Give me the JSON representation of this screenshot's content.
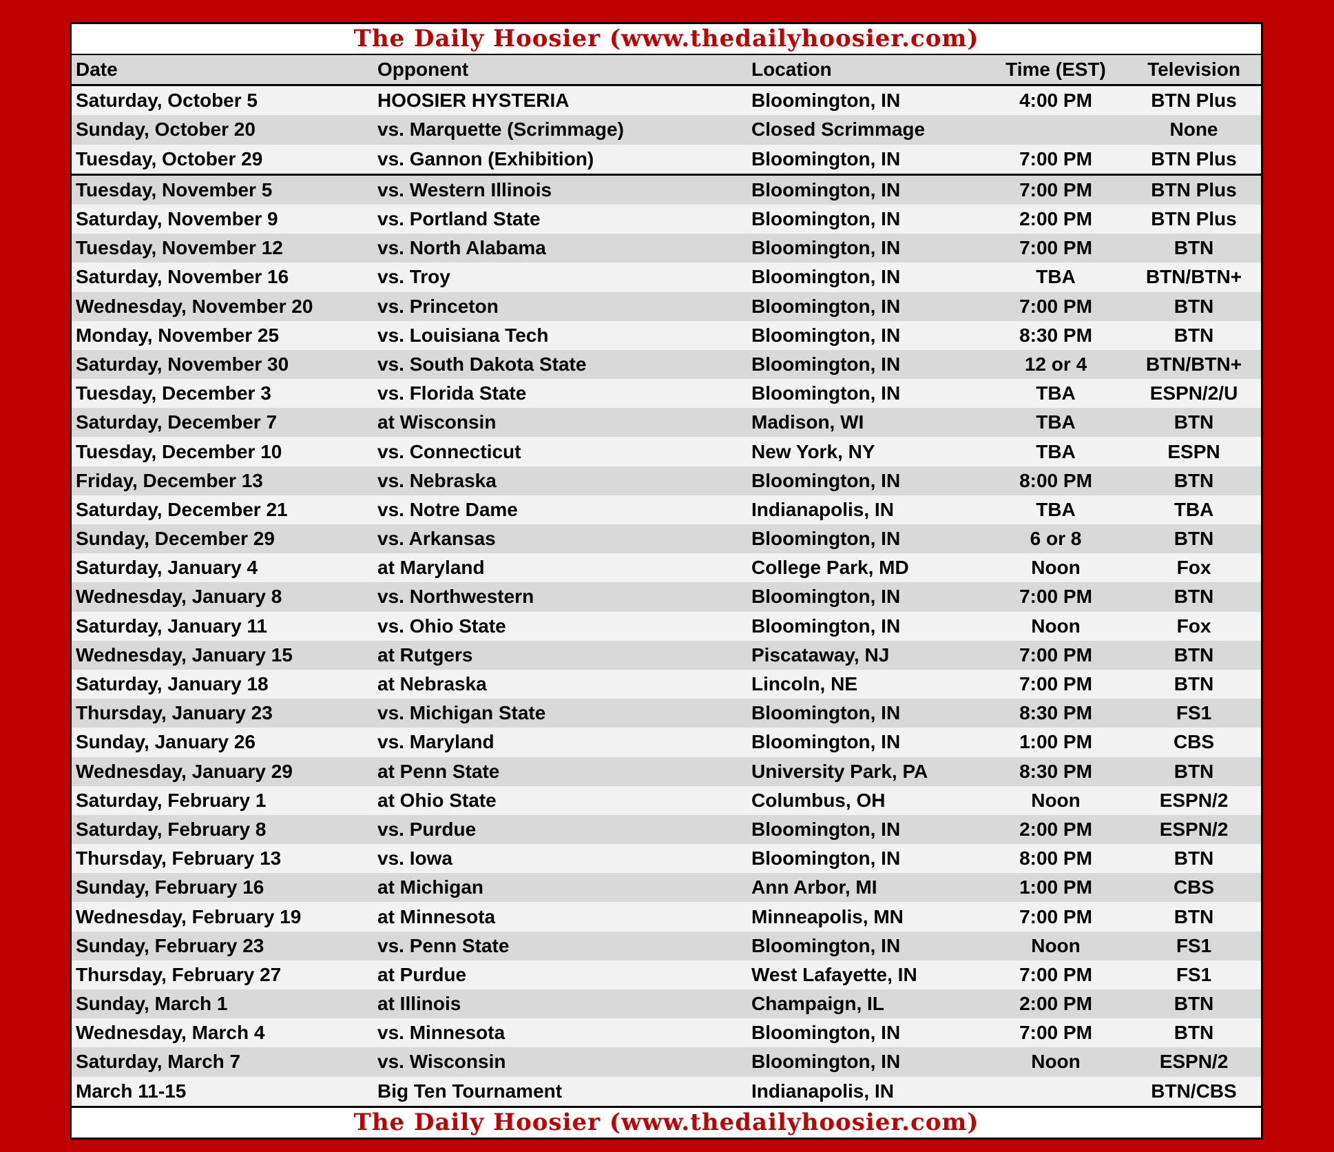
{
  "banner": "The Daily Hoosier (www.thedailyhoosier.com)",
  "columns": [
    "Date",
    "Opponent",
    "Location",
    "Time (EST)",
    "Television"
  ],
  "rows": [
    {
      "date": "Saturday, October 5",
      "opponent": "HOOSIER HYSTERIA",
      "location": "Bloomington, IN",
      "time": "4:00 PM",
      "tv": "BTN Plus"
    },
    {
      "date": "Sunday, October 20",
      "opponent": "vs. Marquette (Scrimmage)",
      "location": "Closed Scrimmage",
      "time": "",
      "tv": "None"
    },
    {
      "date": "Tuesday, October 29",
      "opponent": "vs. Gannon (Exhibition)",
      "location": "Bloomington, IN",
      "time": "7:00 PM",
      "tv": "BTN Plus"
    },
    {
      "date": "Tuesday, November 5",
      "opponent": "vs. Western Illinois",
      "location": "Bloomington, IN",
      "time": "7:00 PM",
      "tv": "BTN Plus"
    },
    {
      "date": "Saturday, November 9",
      "opponent": "vs. Portland State",
      "location": "Bloomington, IN",
      "time": "2:00 PM",
      "tv": "BTN Plus"
    },
    {
      "date": "Tuesday, November 12",
      "opponent": "vs. North Alabama",
      "location": "Bloomington, IN",
      "time": "7:00 PM",
      "tv": "BTN"
    },
    {
      "date": "Saturday, November 16",
      "opponent": "vs. Troy",
      "location": "Bloomington, IN",
      "time": "TBA",
      "tv": "BTN/BTN+"
    },
    {
      "date": "Wednesday, November 20",
      "opponent": "vs. Princeton",
      "location": "Bloomington, IN",
      "time": "7:00 PM",
      "tv": "BTN"
    },
    {
      "date": "Monday, November 25",
      "opponent": "vs. Louisiana Tech",
      "location": "Bloomington, IN",
      "time": "8:30 PM",
      "tv": "BTN"
    },
    {
      "date": "Saturday, November 30",
      "opponent": "vs. South Dakota State",
      "location": "Bloomington, IN",
      "time": "12 or 4",
      "tv": "BTN/BTN+"
    },
    {
      "date": "Tuesday, December 3",
      "opponent": "vs. Florida State",
      "location": "Bloomington, IN",
      "time": "TBA",
      "tv": "ESPN/2/U"
    },
    {
      "date": "Saturday, December 7",
      "opponent": "at Wisconsin",
      "location": "Madison, WI",
      "time": "TBA",
      "tv": "BTN"
    },
    {
      "date": "Tuesday, December 10",
      "opponent": "vs. Connecticut",
      "location": "New York, NY",
      "time": "TBA",
      "tv": "ESPN"
    },
    {
      "date": "Friday, December 13",
      "opponent": "vs. Nebraska",
      "location": "Bloomington, IN",
      "time": "8:00 PM",
      "tv": "BTN"
    },
    {
      "date": "Saturday, December 21",
      "opponent": "vs. Notre Dame",
      "location": "Indianapolis, IN",
      "time": "TBA",
      "tv": "TBA"
    },
    {
      "date": "Sunday, December 29",
      "opponent": "vs. Arkansas",
      "location": "Bloomington, IN",
      "time": "6 or 8",
      "tv": "BTN"
    },
    {
      "date": "Saturday, January 4",
      "opponent": "at Maryland",
      "location": "College Park, MD",
      "time": "Noon",
      "tv": "Fox"
    },
    {
      "date": "Wednesday, January 8",
      "opponent": "vs. Northwestern",
      "location": "Bloomington, IN",
      "time": "7:00 PM",
      "tv": "BTN"
    },
    {
      "date": "Saturday, January 11",
      "opponent": "vs. Ohio State",
      "location": "Bloomington, IN",
      "time": "Noon",
      "tv": "Fox"
    },
    {
      "date": "Wednesday, January 15",
      "opponent": "at Rutgers",
      "location": "Piscataway, NJ",
      "time": "7:00 PM",
      "tv": "BTN"
    },
    {
      "date": "Saturday, January 18",
      "opponent": "at Nebraska",
      "location": "Lincoln, NE",
      "time": "7:00 PM",
      "tv": "BTN"
    },
    {
      "date": "Thursday, January 23",
      "opponent": "vs. Michigan State",
      "location": "Bloomington, IN",
      "time": "8:30 PM",
      "tv": "FS1"
    },
    {
      "date": "Sunday, January 26",
      "opponent": "vs. Maryland",
      "location": "Bloomington, IN",
      "time": "1:00 PM",
      "tv": "CBS"
    },
    {
      "date": "Wednesday, January 29",
      "opponent": "at Penn State",
      "location": "University Park, PA",
      "time": "8:30 PM",
      "tv": "BTN"
    },
    {
      "date": "Saturday, February 1",
      "opponent": "at Ohio State",
      "location": "Columbus, OH",
      "time": "Noon",
      "tv": "ESPN/2"
    },
    {
      "date": "Saturday, February 8",
      "opponent": "vs. Purdue",
      "location": "Bloomington, IN",
      "time": "2:00 PM",
      "tv": "ESPN/2"
    },
    {
      "date": "Thursday, February 13",
      "opponent": "vs. Iowa",
      "location": "Bloomington, IN",
      "time": "8:00 PM",
      "tv": "BTN"
    },
    {
      "date": "Sunday, February 16",
      "opponent": "at Michigan",
      "location": "Ann Arbor, MI",
      "time": "1:00 PM",
      "tv": "CBS"
    },
    {
      "date": "Wednesday, February 19",
      "opponent": "at Minnesota",
      "location": "Minneapolis, MN",
      "time": "7:00 PM",
      "tv": "BTN"
    },
    {
      "date": "Sunday, February 23",
      "opponent": "vs. Penn State",
      "location": "Bloomington, IN",
      "time": "Noon",
      "tv": "FS1"
    },
    {
      "date": "Thursday, February 27",
      "opponent": "at Purdue",
      "location": "West Lafayette, IN",
      "time": "7:00 PM",
      "tv": "FS1"
    },
    {
      "date": "Sunday, March 1",
      "opponent": "at Illinois",
      "location": "Champaign, IL",
      "time": "2:00 PM",
      "tv": "BTN"
    },
    {
      "date": "Wednesday, March 4",
      "opponent": "vs. Minnesota",
      "location": "Bloomington, IN",
      "time": "7:00 PM",
      "tv": "BTN"
    },
    {
      "date": "Saturday, March 7",
      "opponent": "vs. Wisconsin",
      "location": "Bloomington, IN",
      "time": "Noon",
      "tv": "ESPN/2"
    },
    {
      "date": "March 11-15",
      "opponent": "Big Ten Tournament",
      "location": "Indianapolis, IN",
      "time": "",
      "tv": "BTN/CBS"
    }
  ],
  "separator_after_row": 2
}
